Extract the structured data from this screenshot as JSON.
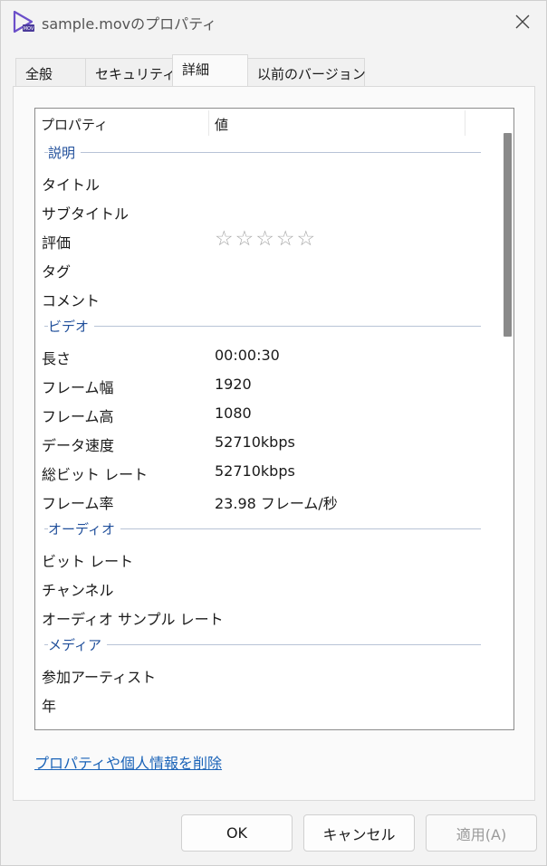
{
  "window": {
    "title": "sample.movのプロパティ",
    "app_icon": "mov-file-icon",
    "close_icon": "close-icon"
  },
  "tabs": [
    {
      "label": "全般",
      "active": false
    },
    {
      "label": "セキュリティ",
      "active": false
    },
    {
      "label": "詳細",
      "active": true
    },
    {
      "label": "以前のバージョン",
      "active": false
    }
  ],
  "list": {
    "headers": {
      "property": "プロパティ",
      "value": "値"
    },
    "groups": {
      "description": {
        "title": "説明",
        "rows": [
          {
            "name": "タイトル",
            "value": ""
          },
          {
            "name": "サブタイトル",
            "value": ""
          },
          {
            "name": "評価",
            "stars": "☆☆☆☆☆",
            "rating": 0
          },
          {
            "name": "タグ",
            "value": ""
          },
          {
            "name": "コメント",
            "value": ""
          }
        ]
      },
      "video": {
        "title": "ビデオ",
        "rows": [
          {
            "name": "長さ",
            "value": "00:00:30"
          },
          {
            "name": "フレーム幅",
            "value": "1920"
          },
          {
            "name": "フレーム高",
            "value": "1080"
          },
          {
            "name": "データ速度",
            "value": "52710kbps"
          },
          {
            "name": "総ビット レート",
            "value": "52710kbps"
          },
          {
            "name": "フレーム率",
            "value": "23.98 フレーム/秒"
          }
        ]
      },
      "audio": {
        "title": "オーディオ",
        "rows": [
          {
            "name": "ビット レート",
            "value": ""
          },
          {
            "name": "チャンネル",
            "value": ""
          },
          {
            "name": "オーディオ サンプル レート",
            "value": ""
          }
        ]
      },
      "media": {
        "title": "メディア",
        "rows": [
          {
            "name": "参加アーティスト",
            "value": ""
          },
          {
            "name": "年",
            "value": ""
          }
        ]
      }
    },
    "scroll_position": 0.0
  },
  "remove_link": "プロパティや個人情報を削除",
  "buttons": {
    "ok": "OK",
    "cancel": "キャンセル",
    "apply": "適用(A)"
  },
  "colors": {
    "accent": "#1a63b8",
    "group_title": "#1f4e9a",
    "disabled_text": "#9a9a9a",
    "icon_purple": "#6b4fc9"
  }
}
